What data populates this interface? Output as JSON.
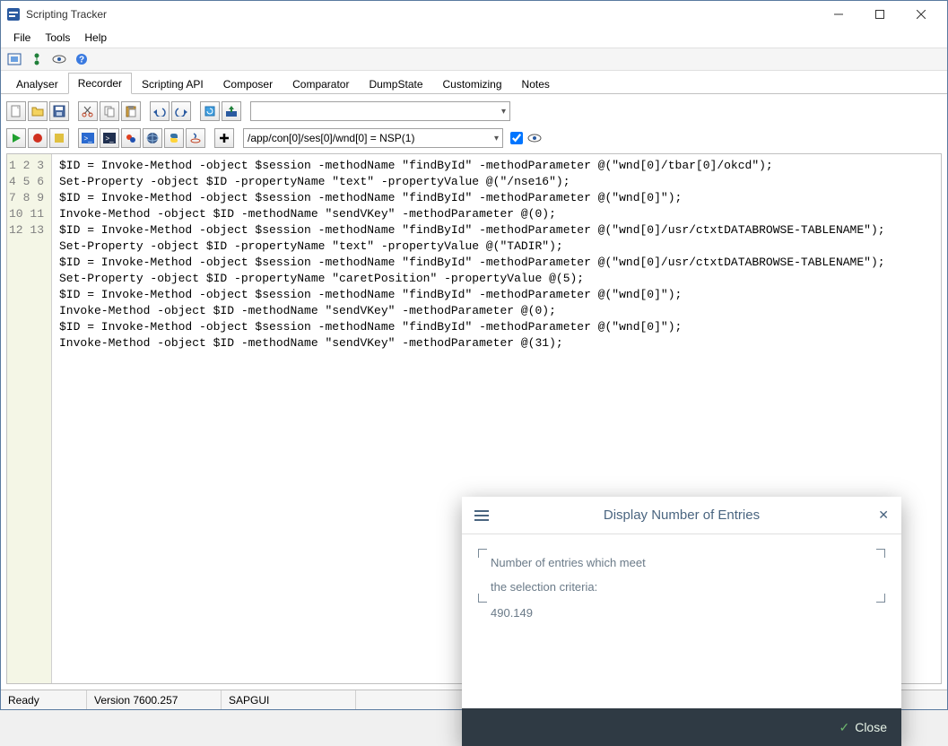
{
  "window": {
    "title": "Scripting Tracker"
  },
  "menu": {
    "file": "File",
    "tools": "Tools",
    "help": "Help"
  },
  "tabs": {
    "t0": "Analyser",
    "t1": "Recorder",
    "t2": "Scripting API",
    "t3": "Composer",
    "t4": "Comparator",
    "t5": "DumpState",
    "t6": "Customizing",
    "t7": "Notes",
    "active": "t1"
  },
  "toolbar2": {
    "path": "/app/con[0]/ses[0]/wnd[0] = NSP(1)"
  },
  "code": {
    "lines": [
      "$ID = Invoke-Method -object $session -methodName \"findById\" -methodParameter @(\"wnd[0]/tbar[0]/okcd\");",
      "Set-Property -object $ID -propertyName \"text\" -propertyValue @(\"/nse16\");",
      "$ID = Invoke-Method -object $session -methodName \"findById\" -methodParameter @(\"wnd[0]\");",
      "Invoke-Method -object $ID -methodName \"sendVKey\" -methodParameter @(0);",
      "$ID = Invoke-Method -object $session -methodName \"findById\" -methodParameter @(\"wnd[0]/usr/ctxtDATABROWSE-TABLENAME\");",
      "Set-Property -object $ID -propertyName \"text\" -propertyValue @(\"TADIR\");",
      "$ID = Invoke-Method -object $session -methodName \"findById\" -methodParameter @(\"wnd[0]/usr/ctxtDATABROWSE-TABLENAME\");",
      "Set-Property -object $ID -propertyName \"caretPosition\" -propertyValue @(5);",
      "$ID = Invoke-Method -object $session -methodName \"findById\" -methodParameter @(\"wnd[0]\");",
      "Invoke-Method -object $ID -methodName \"sendVKey\" -methodParameter @(0);",
      "$ID = Invoke-Method -object $session -methodName \"findById\" -methodParameter @(\"wnd[0]\");",
      "Invoke-Method -object $ID -methodName \"sendVKey\" -methodParameter @(31);"
    ]
  },
  "dialog": {
    "title": "Display Number of Entries",
    "line1": "Number of entries which meet",
    "line2": "the selection criteria:",
    "value": "490.149",
    "close": "Close"
  },
  "status": {
    "s0": "Ready",
    "s1": "Version 7600.257",
    "s2": "SAPGUI"
  }
}
